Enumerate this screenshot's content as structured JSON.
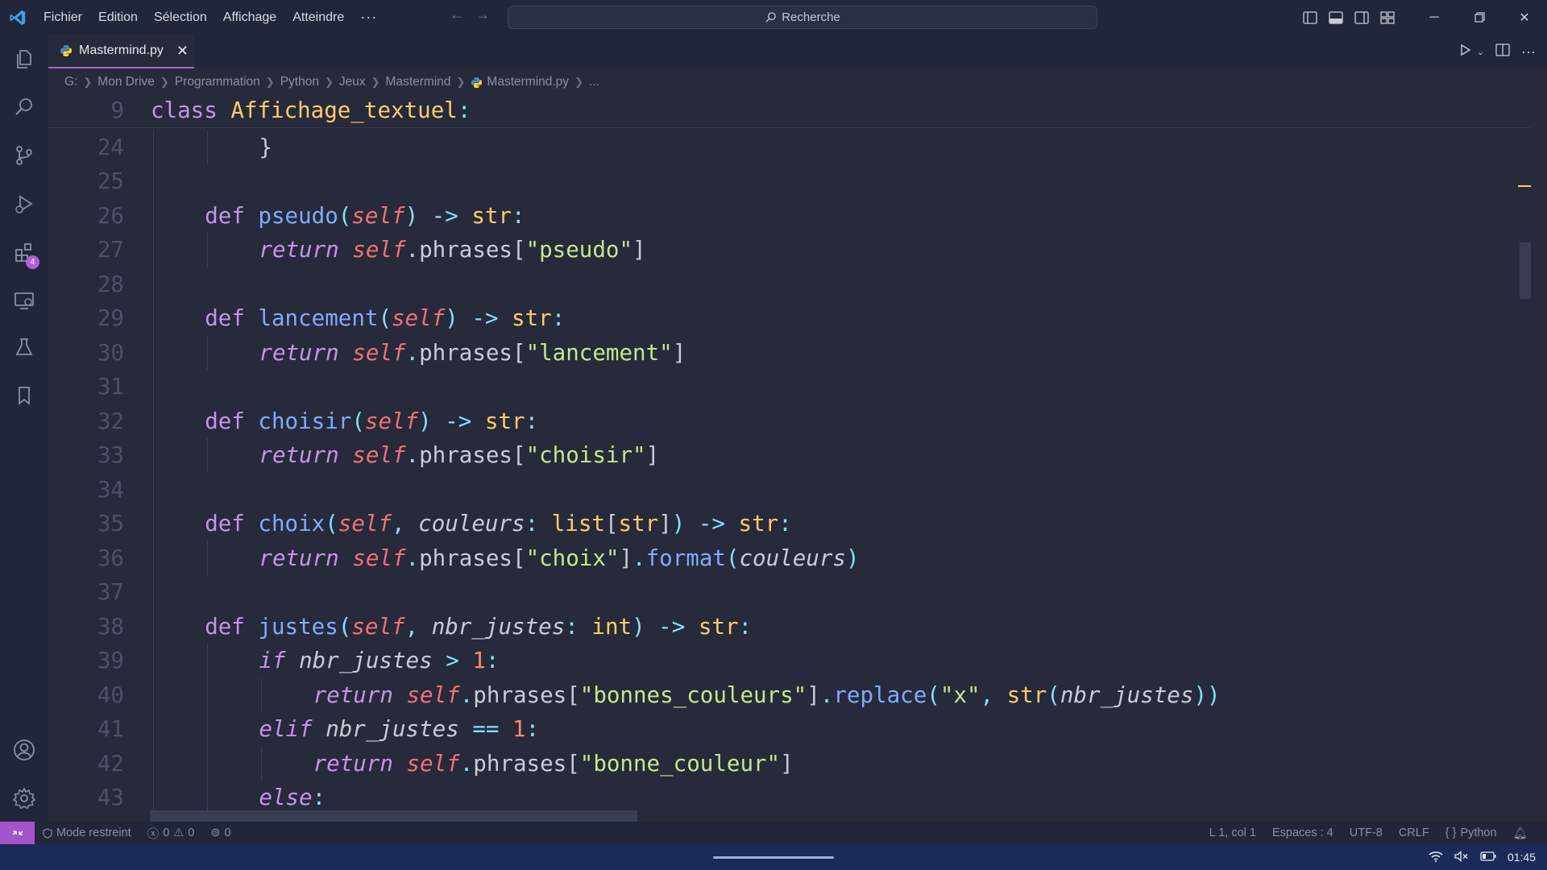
{
  "titlebar": {
    "menu": [
      "Fichier",
      "Edition",
      "Sélection",
      "Affichage",
      "Atteindre"
    ],
    "more": "···",
    "search_placeholder": "Recherche"
  },
  "tab": {
    "name": "Mastermind.py",
    "close": "✕"
  },
  "breadcrumb": [
    "G:",
    "Mon Drive",
    "Programmation",
    "Python",
    "Jeux",
    "Mastermind",
    "Mastermind.py",
    "..."
  ],
  "extensions_badge": "4",
  "editor": {
    "sticky": {
      "number": "9",
      "tokens": [
        [
          "kw",
          "class "
        ],
        [
          "cls",
          "Affichage_textuel"
        ],
        [
          "op",
          ":"
        ]
      ]
    },
    "lines": [
      {
        "number": "24",
        "indent": 2,
        "tokens": [
          [
            "par",
            "}"
          ]
        ]
      },
      {
        "number": "25",
        "indent": 0,
        "tokens": []
      },
      {
        "number": "26",
        "indent": 1,
        "tokens": [
          [
            "kw",
            "def "
          ],
          [
            "fn",
            "pseudo"
          ],
          [
            "op",
            "("
          ],
          [
            "self",
            "self"
          ],
          [
            "op",
            ") -> "
          ],
          [
            "typ",
            "str"
          ],
          [
            "op",
            ":"
          ]
        ]
      },
      {
        "number": "27",
        "indent": 2,
        "tokens": [
          [
            "kw it",
            "return "
          ],
          [
            "self",
            "self"
          ],
          [
            "op",
            "."
          ],
          [
            "var",
            "phrases"
          ],
          [
            "par",
            "["
          ],
          [
            "str",
            "\"pseudo\""
          ],
          [
            "par",
            "]"
          ]
        ]
      },
      {
        "number": "28",
        "indent": 0,
        "tokens": []
      },
      {
        "number": "29",
        "indent": 1,
        "tokens": [
          [
            "kw",
            "def "
          ],
          [
            "fn",
            "lancement"
          ],
          [
            "op",
            "("
          ],
          [
            "self",
            "self"
          ],
          [
            "op",
            ") -> "
          ],
          [
            "typ",
            "str"
          ],
          [
            "op",
            ":"
          ]
        ]
      },
      {
        "number": "30",
        "indent": 2,
        "tokens": [
          [
            "kw it",
            "return "
          ],
          [
            "self",
            "self"
          ],
          [
            "op",
            "."
          ],
          [
            "var",
            "phrases"
          ],
          [
            "par",
            "["
          ],
          [
            "str",
            "\"lancement\""
          ],
          [
            "par",
            "]"
          ]
        ]
      },
      {
        "number": "31",
        "indent": 0,
        "tokens": []
      },
      {
        "number": "32",
        "indent": 1,
        "tokens": [
          [
            "kw",
            "def "
          ],
          [
            "fn",
            "choisir"
          ],
          [
            "op",
            "("
          ],
          [
            "self",
            "self"
          ],
          [
            "op",
            ") -> "
          ],
          [
            "typ",
            "str"
          ],
          [
            "op",
            ":"
          ]
        ]
      },
      {
        "number": "33",
        "indent": 2,
        "tokens": [
          [
            "kw it",
            "return "
          ],
          [
            "self",
            "self"
          ],
          [
            "op",
            "."
          ],
          [
            "var",
            "phrases"
          ],
          [
            "par",
            "["
          ],
          [
            "str",
            "\"choisir\""
          ],
          [
            "par",
            "]"
          ]
        ]
      },
      {
        "number": "34",
        "indent": 0,
        "tokens": []
      },
      {
        "number": "35",
        "indent": 1,
        "tokens": [
          [
            "kw",
            "def "
          ],
          [
            "fn",
            "choix"
          ],
          [
            "op",
            "("
          ],
          [
            "self",
            "self"
          ],
          [
            "op",
            ", "
          ],
          [
            "prm",
            "couleurs"
          ],
          [
            "op",
            ": "
          ],
          [
            "typ",
            "list"
          ],
          [
            "par",
            "["
          ],
          [
            "typ",
            "str"
          ],
          [
            "par",
            "]"
          ],
          [
            "op",
            ") -> "
          ],
          [
            "typ",
            "str"
          ],
          [
            "op",
            ":"
          ]
        ]
      },
      {
        "number": "36",
        "indent": 2,
        "tokens": [
          [
            "kw it",
            "return "
          ],
          [
            "self",
            "self"
          ],
          [
            "op",
            "."
          ],
          [
            "var",
            "phrases"
          ],
          [
            "par",
            "["
          ],
          [
            "str",
            "\"choix\""
          ],
          [
            "par",
            "]"
          ],
          [
            "op",
            "."
          ],
          [
            "fn",
            "format"
          ],
          [
            "op",
            "("
          ],
          [
            "prm",
            "couleurs"
          ],
          [
            "op",
            ")"
          ]
        ]
      },
      {
        "number": "37",
        "indent": 0,
        "tokens": []
      },
      {
        "number": "38",
        "indent": 1,
        "tokens": [
          [
            "kw",
            "def "
          ],
          [
            "fn",
            "justes"
          ],
          [
            "op",
            "("
          ],
          [
            "self",
            "self"
          ],
          [
            "op",
            ", "
          ],
          [
            "prm",
            "nbr_justes"
          ],
          [
            "op",
            ": "
          ],
          [
            "typ",
            "int"
          ],
          [
            "op",
            ") -> "
          ],
          [
            "typ",
            "str"
          ],
          [
            "op",
            ":"
          ]
        ]
      },
      {
        "number": "39",
        "indent": 2,
        "tokens": [
          [
            "kw it",
            "if "
          ],
          [
            "prm",
            "nbr_justes"
          ],
          [
            "op",
            " > "
          ],
          [
            "num",
            "1"
          ],
          [
            "op",
            ":"
          ]
        ]
      },
      {
        "number": "40",
        "indent": 3,
        "tokens": [
          [
            "kw it",
            "return "
          ],
          [
            "self",
            "self"
          ],
          [
            "op",
            "."
          ],
          [
            "var",
            "phrases"
          ],
          [
            "par",
            "["
          ],
          [
            "str",
            "\"bonnes_couleurs\""
          ],
          [
            "par",
            "]"
          ],
          [
            "op",
            "."
          ],
          [
            "fn",
            "replace"
          ],
          [
            "op",
            "("
          ],
          [
            "str",
            "\"x\""
          ],
          [
            "op",
            ", "
          ],
          [
            "typ",
            "str"
          ],
          [
            "op",
            "("
          ],
          [
            "prm",
            "nbr_justes"
          ],
          [
            "op",
            "))"
          ]
        ]
      },
      {
        "number": "41",
        "indent": 2,
        "tokens": [
          [
            "kw it",
            "elif "
          ],
          [
            "prm",
            "nbr_justes"
          ],
          [
            "op",
            " == "
          ],
          [
            "num",
            "1"
          ],
          [
            "op",
            ":"
          ]
        ]
      },
      {
        "number": "42",
        "indent": 3,
        "tokens": [
          [
            "kw it",
            "return "
          ],
          [
            "self",
            "self"
          ],
          [
            "op",
            "."
          ],
          [
            "var",
            "phrases"
          ],
          [
            "par",
            "["
          ],
          [
            "str",
            "\"bonne_couleur\""
          ],
          [
            "par",
            "]"
          ]
        ]
      },
      {
        "number": "43",
        "indent": 2,
        "tokens": [
          [
            "kw it",
            "else"
          ],
          [
            "op",
            ":"
          ]
        ]
      }
    ]
  },
  "statusbar": {
    "mode": "Mode restreint",
    "errors": "0",
    "warnings": "0",
    "ports": "0",
    "position": "L 1, col 1",
    "spaces": "Espaces : 4",
    "encoding": "UTF-8",
    "eol": "CRLF",
    "language": "Python"
  },
  "taskbar": {
    "time": "01:45"
  }
}
